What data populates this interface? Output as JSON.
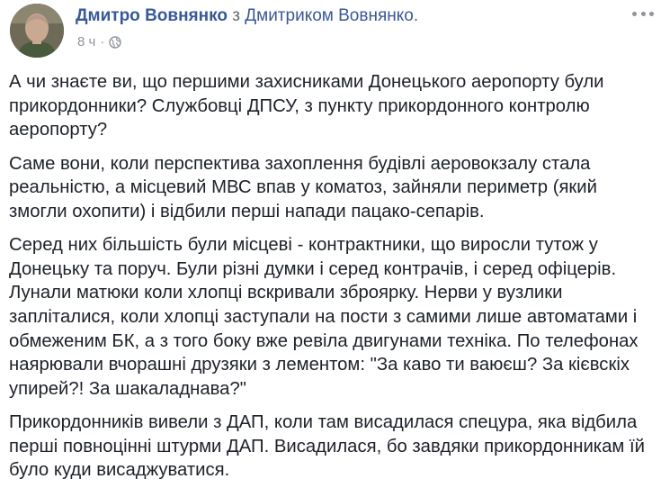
{
  "post": {
    "author": "Дмитро Вовнянко",
    "with_word": "з",
    "tagged_user": "Дмитриком Вовнянко",
    "period": ".",
    "time": "8 ч",
    "separator": "·",
    "privacy_icon": "globe-icon",
    "more_icon": "more-options-icon",
    "paragraphs": [
      "А чи знаєте ви, що першими захисниками Донецького аеропорту були прикордонники? Службовці ДПСУ, з пункту прикордонного контролю аеропорту?",
      "Саме вони, коли перспектива захоплення будівлі аеровокзалу стала реальністю, а місцевий МВС впав у коматоз, зайняли периметр (який змогли охопити) і відбили перші напади пацако-сепарів.",
      "Серед них більшість були місцеві - контрактники, що виросли тутож у Донецьку та поруч. Були різні думки і серед контрачів, і серед офіцерів. Лунали матюки коли хлопці вскривали зброярку. Нерви у вузлики запліталися, коли хлопці заступали на пости з самими лише автоматами і обмеженим БК, а з того боку вже ревіла двигунами техніка. По телефонах наярювали вчорашні друзяки з лементом: \"За каво ти ваюєш? За кієвскіх упирей?! За шакаладнава?\"",
      "Прикордонників вивели з ДАП, коли там висадилася спецура, яка відбила перші повноцінні штурми ДАП. Висадилася, бо завдяки прикордонникам їй було куди висаджуватися."
    ]
  },
  "colors": {
    "link": "#385898",
    "text": "#1d2129",
    "meta": "#90949c"
  }
}
